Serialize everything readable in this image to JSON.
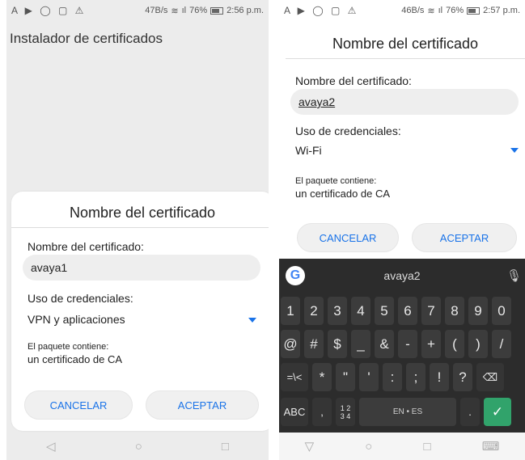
{
  "left": {
    "status": {
      "icons": "A ▶ ◯ ▢ ⚠",
      "speed": "47B/s",
      "signal": "ıl",
      "battery": "76%",
      "time": "2:56 p.m."
    },
    "app_title": "Instalador de certificados",
    "dialog": {
      "title": "Nombre del certificado",
      "name_label": "Nombre del certificado:",
      "name_value": "avaya1",
      "cred_label": "Uso de credenciales:",
      "cred_value": "VPN y aplicaciones",
      "package_label": "El paquete contiene:",
      "package_value": "un certificado de CA",
      "cancel": "CANCELAR",
      "accept": "ACEPTAR"
    },
    "nav": {
      "back": "◁",
      "home": "○",
      "recent": "□"
    }
  },
  "right": {
    "status": {
      "icons": "A ▶ ◯ ▢ ⚠",
      "speed": "46B/s",
      "signal": "ıl",
      "battery": "76%",
      "time": "2:57 p.m."
    },
    "dialog": {
      "title": "Nombre del certificado",
      "name_label": "Nombre del certificado:",
      "name_value": "avaya2",
      "cred_label": "Uso de credenciales:",
      "cred_value": "Wi-Fi",
      "package_label": "El paquete contiene:",
      "package_value": "un certificado de CA",
      "cancel": "CANCELAR",
      "accept": "ACEPTAR"
    },
    "keyboard": {
      "suggestion": "avaya2",
      "google_logo": "G",
      "mic_icon": "🎙",
      "row1": [
        "1",
        "2",
        "3",
        "4",
        "5",
        "6",
        "7",
        "8",
        "9",
        "0"
      ],
      "row2": [
        "@",
        "#",
        "$",
        "_",
        "&",
        "-",
        "+",
        "(",
        ")",
        "/"
      ],
      "row3": [
        "=\\<",
        "*",
        "\"",
        "'",
        ":",
        ";",
        "!",
        "?",
        "⌫"
      ],
      "row4": {
        "abc": "ABC",
        "comma": ",",
        "numpad": "1 2\n3 4",
        "space": "EN • ES",
        "period": ".",
        "enter": "✓"
      }
    },
    "nav": {
      "back": "▽",
      "home": "○",
      "recent": "□",
      "keyboard": "⌨"
    }
  },
  "colors": {
    "accent": "#1a73e8",
    "keyboard_bg": "#2c2c2c",
    "enter_key": "#31a36b"
  }
}
